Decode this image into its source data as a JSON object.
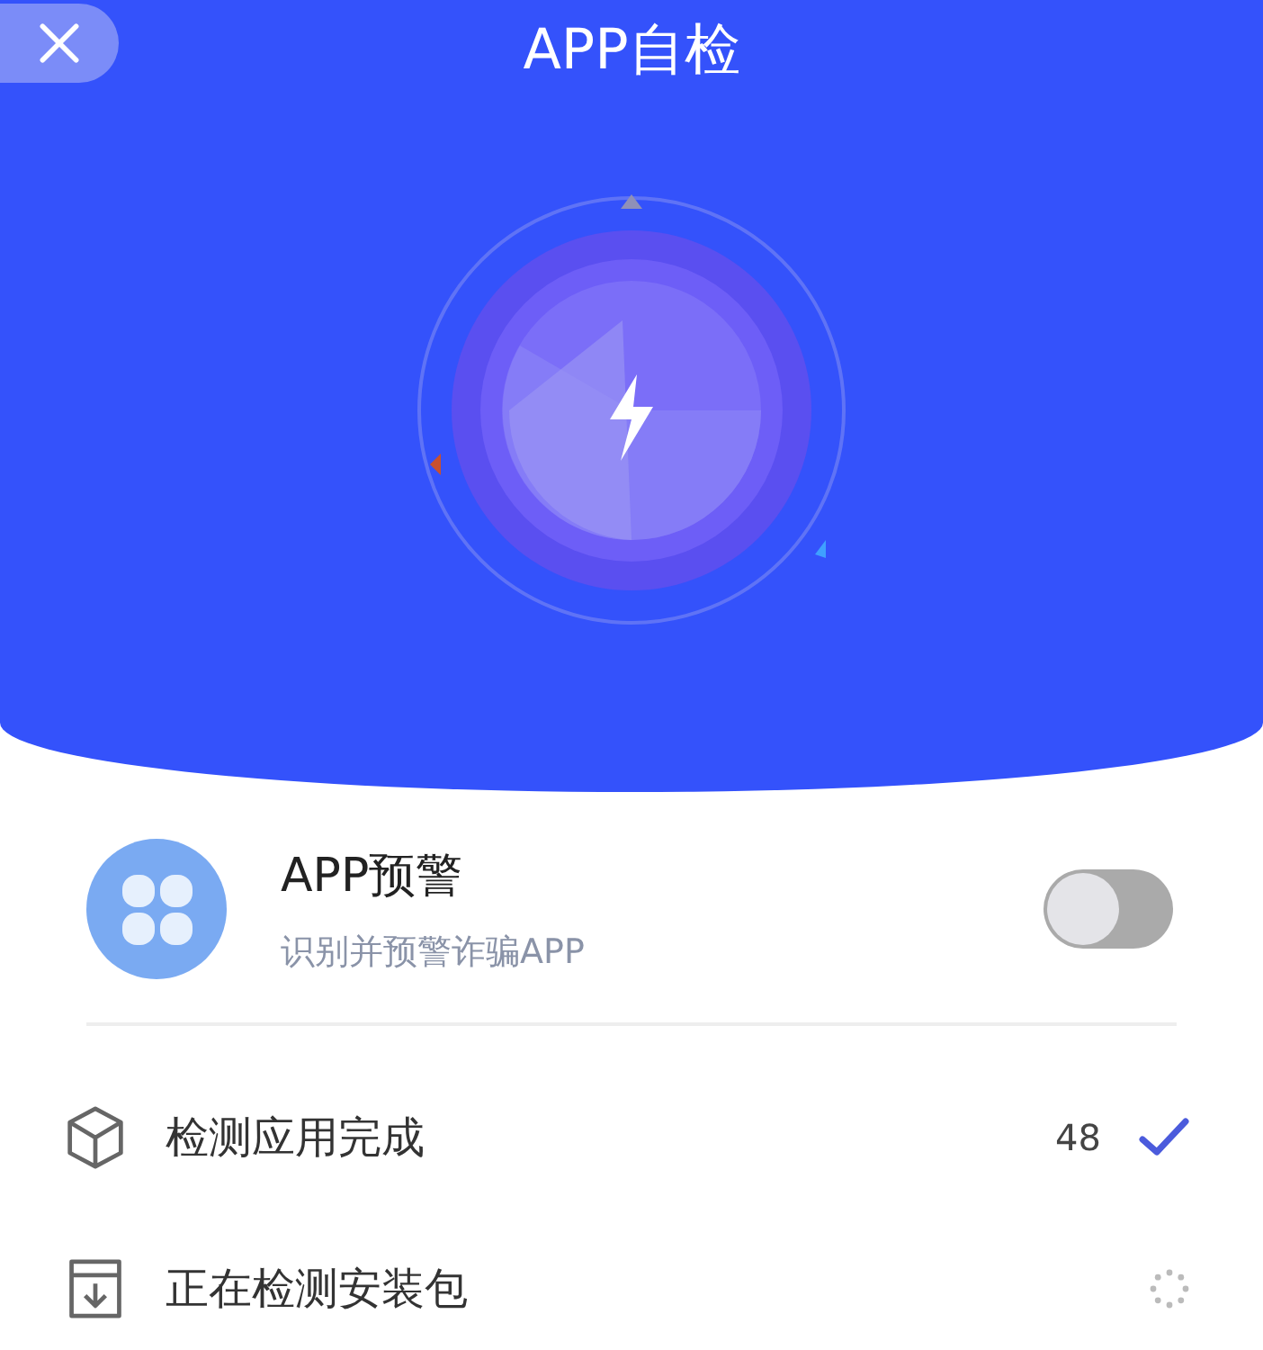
{
  "header": {
    "title": "APP自检"
  },
  "warning": {
    "title": "APP预警",
    "subtitle": "识别并预警诈骗APP",
    "on": false
  },
  "checks": [
    {
      "kind": "done",
      "label": "检测应用完成",
      "count": "48"
    },
    {
      "kind": "running",
      "label": "正在检测安装包"
    }
  ]
}
